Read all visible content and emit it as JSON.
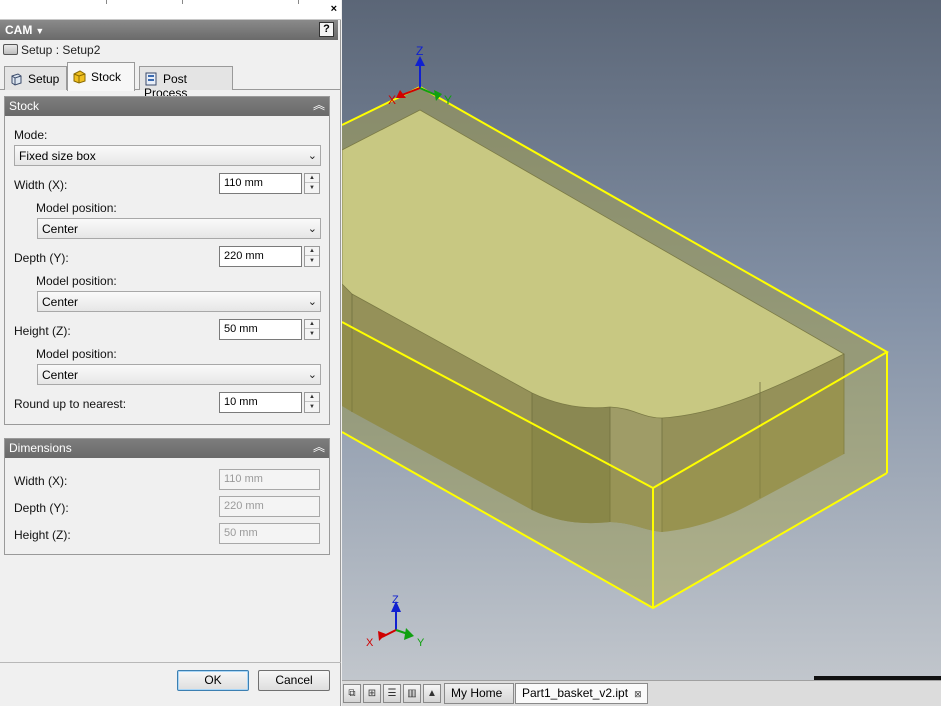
{
  "panel": {
    "title": "CAM",
    "help": "?",
    "top_close": "×",
    "breadcrumb": "Setup : Setup2",
    "tabs": [
      {
        "label": "Setup",
        "active": false
      },
      {
        "label": "Stock",
        "active": true
      },
      {
        "label": "Post Process",
        "active": false
      }
    ],
    "stock": {
      "title": "Stock",
      "mode_label": "Mode:",
      "mode_value": "Fixed size box",
      "width_label": "Width (X):",
      "width_value": "110 mm",
      "width_pos_label": "Model position:",
      "width_pos_value": "Center",
      "depth_label": "Depth (Y):",
      "depth_value": "220 mm",
      "depth_pos_label": "Model position:",
      "depth_pos_value": "Center",
      "height_label": "Height (Z):",
      "height_value": "50 mm",
      "height_pos_label": "Model position:",
      "height_pos_value": "Center",
      "round_label": "Round up to nearest:",
      "round_value": "10 mm"
    },
    "dimensions": {
      "title": "Dimensions",
      "width_label": "Width (X):",
      "width_value": "110 mm",
      "depth_label": "Depth (Y):",
      "depth_value": "220 mm",
      "height_label": "Height (Z):",
      "height_value": "50 mm"
    },
    "ok_label": "OK",
    "cancel_label": "Cancel"
  },
  "viewport": {
    "axis_labels": {
      "x": "X",
      "y": "Y",
      "z": "Z"
    },
    "colors": {
      "stock_edge": "#ffff00",
      "model_top": "#c9c98a",
      "axis_x": "#d00000",
      "axis_y": "#10a010",
      "axis_z": "#1020d0"
    }
  },
  "tabbar": {
    "tabs": [
      {
        "label": "My Home",
        "active": false
      },
      {
        "label": "Part1_basket_v2.ipt",
        "active": true
      }
    ],
    "close_glyph": "⊠"
  }
}
